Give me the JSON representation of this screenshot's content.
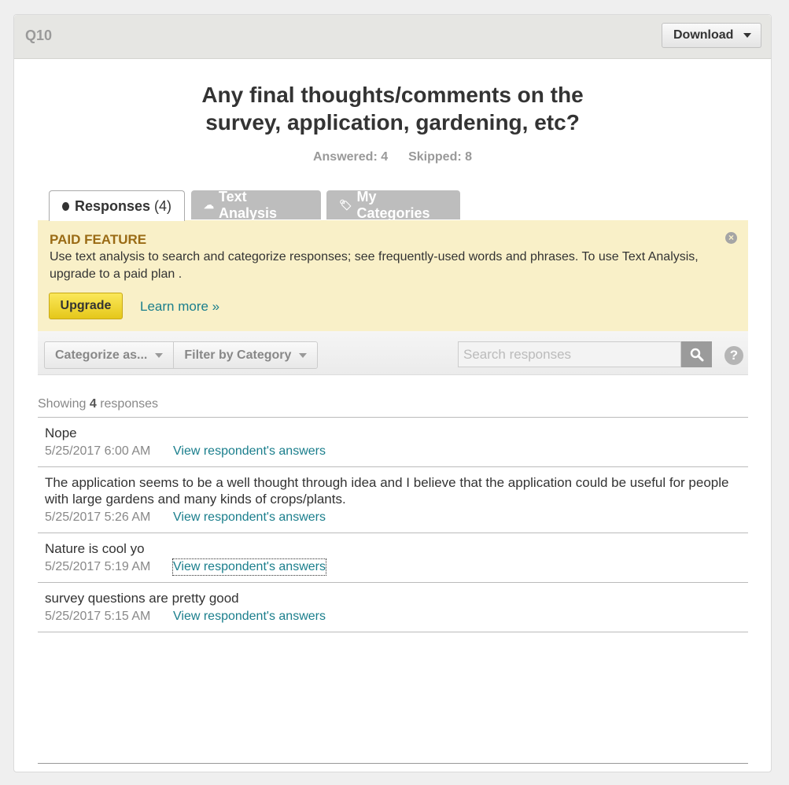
{
  "header": {
    "question_number": "Q10",
    "download_label": "Download"
  },
  "question": {
    "line1": "Any final thoughts/comments on the",
    "line2": "survey, application, gardening, etc?",
    "answered": "Answered: 4",
    "skipped": "Skipped: 8"
  },
  "tabs": [
    {
      "label": "Responses",
      "count": "(4)",
      "icon": "speech-bubble-icon",
      "active": true
    },
    {
      "label": "Text Analysis",
      "icon": "cloud-icon",
      "active": false
    },
    {
      "label": "My Categories",
      "icon": "tag-icon",
      "active": false
    }
  ],
  "paid_feature": {
    "title": "PAID FEATURE",
    "text": "Use text analysis to search and categorize responses; see frequently-used words and phrases. To use Text Analysis, upgrade to a paid plan .",
    "upgrade_label": "Upgrade",
    "learn_more_label": "Learn more »"
  },
  "toolbar": {
    "categorize_label": "Categorize as...",
    "filter_label": "Filter by Category",
    "search_placeholder": "Search responses"
  },
  "showing": {
    "prefix": "Showing",
    "count": "4",
    "suffix": "responses"
  },
  "responses": [
    {
      "text": "Nope",
      "date": "5/25/2017 6:00 AM",
      "link": "View respondent's answers"
    },
    {
      "text": "The application seems to be a well thought through idea and I believe that the application could be useful for people with large gardens and many kinds of crops/plants.",
      "date": "5/25/2017 5:26 AM",
      "link": "View respondent's answers"
    },
    {
      "text": "Nature is cool yo",
      "date": "5/25/2017 5:19 AM",
      "link": "View respondent's answers"
    },
    {
      "text": "survey questions are pretty good",
      "date": "5/25/2017 5:15 AM",
      "link": "View respondent's answers"
    }
  ],
  "colors": {
    "accent_link": "#1a7e8c",
    "paid_bg": "#f9f0c8",
    "paid_title": "#9a6b15",
    "upgrade": "#f0d63a"
  }
}
